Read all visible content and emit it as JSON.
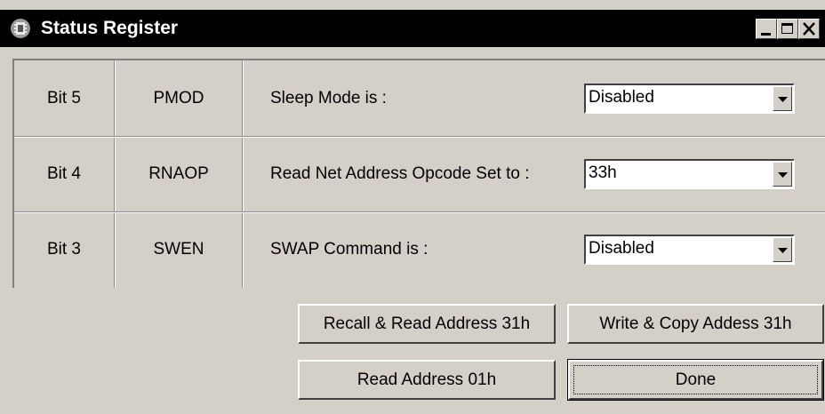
{
  "window": {
    "title": "Status Register",
    "icon": "chip-icon",
    "controls": {
      "minimize": "minimize-icon",
      "maximize": "maximize-icon",
      "close": "close-icon"
    }
  },
  "rows": [
    {
      "bit": "Bit 5",
      "name": "PMOD",
      "label": "Sleep Mode is :",
      "value": "Disabled"
    },
    {
      "bit": "Bit 4",
      "name": "RNAOP",
      "label": "Read Net Address Opcode Set to :",
      "value": "33h"
    },
    {
      "bit": "Bit 3",
      "name": "SWEN",
      "label": "SWAP Command is :",
      "value": "Disabled"
    }
  ],
  "buttons": {
    "recall_read": "Recall & Read Address 31h",
    "write_copy": "Write & Copy Addess 31h",
    "read_address": "Read Address 01h",
    "done": "Done"
  },
  "colors": {
    "face": "#d4d0c8",
    "titlebar": "#000000",
    "field": "#ffffff"
  }
}
